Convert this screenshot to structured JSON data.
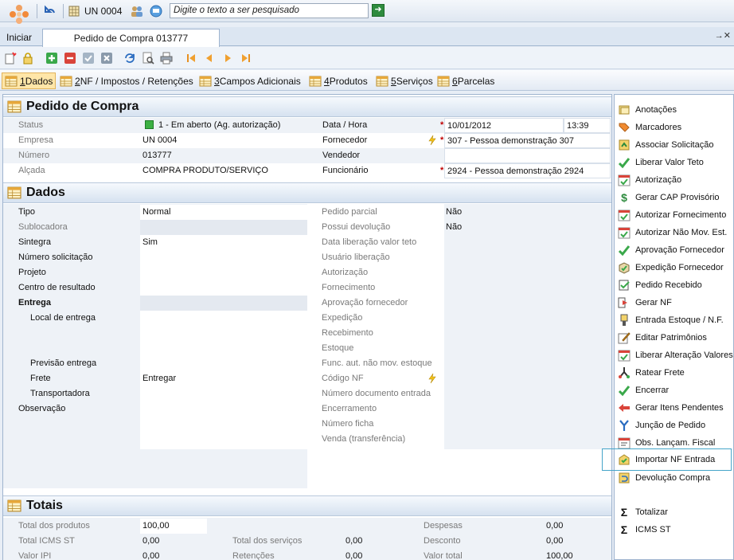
{
  "topbar": {
    "unit_label": "UN 0004",
    "search_placeholder": "Digite o texto a ser pesquisado"
  },
  "tabs": {
    "home": "Iniciar",
    "active": "Pedido de Compra 013777",
    "close_glyph": "→✕"
  },
  "section_tabs": [
    {
      "num": "1",
      "label": " Dados"
    },
    {
      "num": "2",
      "label": " NF / Impostos / Retenções"
    },
    {
      "num": "3",
      "label": " Campos Adicionais"
    },
    {
      "num": "4",
      "label": " Produtos"
    },
    {
      "num": "5",
      "label": " Serviços"
    },
    {
      "num": "6",
      "label": " Parcelas"
    }
  ],
  "pedido": {
    "title": "Pedido de Compra",
    "status_label": "Status",
    "status_value": "1 - Em aberto (Ag. autorização)",
    "empresa_label": "Empresa",
    "empresa_value": "UN 0004",
    "numero_label": "Número",
    "numero_value": "013777",
    "alcada_label": "Alçada",
    "alcada_value": "COMPRA PRODUTO/SERVIÇO",
    "data_label": "Data / Hora",
    "data_value": "10/01/2012",
    "hora_value": "13:39",
    "fornecedor_label": "Fornecedor",
    "fornecedor_value": "307 - Pessoa demonstração 307",
    "vendedor_label": "Vendedor",
    "funcionario_label": "Funcionário",
    "funcionario_value": "2924 - Pessoa demonstração 2924",
    "required_mark": "*"
  },
  "dados": {
    "title": "Dados",
    "left": [
      {
        "label": "Tipo",
        "value": "Normal",
        "style": "lbl",
        "bg": "white"
      },
      {
        "label": "Sublocadora",
        "value": "",
        "style": "lbl-gray",
        "bg": "gray"
      },
      {
        "label": "Sintegra",
        "value": "Sim",
        "style": "lbl",
        "bg": "white"
      },
      {
        "label": "Número solicitação",
        "value": "",
        "style": "lbl",
        "bg": "white"
      },
      {
        "label": "Projeto",
        "value": "",
        "style": "lbl",
        "bg": "white"
      },
      {
        "label": "Centro de resultado",
        "value": "",
        "style": "lbl",
        "bg": "white"
      },
      {
        "label": "Entrega",
        "value": "",
        "style": "bold",
        "bg": "gray"
      }
    ],
    "local_entrega_label": "Local de entrega",
    "previsao_label": "Previsão entrega",
    "frete_label": "Frete",
    "frete_value": "Entregar",
    "transportadora_label": "Transportadora",
    "observacao_label": "Observação",
    "right": [
      {
        "label": "Pedido parcial",
        "value": "Não"
      },
      {
        "label": "Possui devolução",
        "value": "Não"
      },
      {
        "label": "Data liberação valor teto",
        "value": ""
      },
      {
        "label": "Usuário liberação",
        "value": ""
      },
      {
        "label": "Autorização",
        "value": ""
      },
      {
        "label": "Fornecimento",
        "value": ""
      },
      {
        "label": "Aprovação fornecedor",
        "value": ""
      },
      {
        "label": "Expedição",
        "value": ""
      },
      {
        "label": "Recebimento",
        "value": ""
      },
      {
        "label": "Estoque",
        "value": ""
      },
      {
        "label": "Func. aut. não mov. estoque",
        "value": ""
      },
      {
        "label": "Código NF",
        "value": ""
      },
      {
        "label": "Número documento entrada",
        "value": ""
      },
      {
        "label": "Encerramento",
        "value": ""
      },
      {
        "label": "Número ficha",
        "value": ""
      },
      {
        "label": "Venda (transferência)",
        "value": ""
      }
    ]
  },
  "totais": {
    "title": "Totais",
    "rows": [
      [
        {
          "label": "Total dos produtos",
          "value": "100,00"
        },
        {
          "label": "",
          "value": ""
        },
        {
          "label": "Despesas",
          "value": "0,00"
        }
      ],
      [
        {
          "label": "Total ICMS ST",
          "value": "0,00"
        },
        {
          "label": "Total dos serviços",
          "value": "0,00"
        },
        {
          "label": "Desconto",
          "value": "0,00"
        }
      ],
      [
        {
          "label": "Valor IPI",
          "value": "0,00"
        },
        {
          "label": "Retenções",
          "value": "0,00"
        },
        {
          "label": "Valor total",
          "value": "100,00"
        }
      ]
    ]
  },
  "sidebar": {
    "items": [
      {
        "label": "Anotações",
        "icon": "notes-icon",
        "accel": "A"
      },
      {
        "label": "Marcadores",
        "icon": "tag-icon"
      },
      {
        "label": "Associar Solicitação",
        "icon": "link-request-icon"
      },
      {
        "label": "Liberar Valor Teto",
        "icon": "check-icon"
      },
      {
        "label": "Autorização",
        "icon": "calendar-check-icon"
      },
      {
        "label": "Gerar CAP Provisório",
        "icon": "dollar-icon"
      },
      {
        "label": "Autorizar Fornecimento",
        "icon": "calendar-check-icon"
      },
      {
        "label": "Autorizar Não Mov. Est.",
        "icon": "calendar-check-icon"
      },
      {
        "label": "Aprovação Fornecedor",
        "icon": "check-icon"
      },
      {
        "label": "Expedição Fornecedor",
        "icon": "box-check-icon"
      },
      {
        "label": "Pedido Recebido",
        "icon": "received-icon"
      },
      {
        "label": "Gerar NF",
        "icon": "arrow-doc-icon"
      },
      {
        "label": "Entrada Estoque / N.F.",
        "icon": "stock-entry-icon"
      },
      {
        "label": "Editar Patrimônios",
        "icon": "edit-icon"
      },
      {
        "label": "Liberar Alteração Valores",
        "icon": "calendar-check-icon"
      },
      {
        "label": "Ratear Frete",
        "icon": "split-icon"
      },
      {
        "label": "Encerrar",
        "icon": "check-icon"
      },
      {
        "label": "Gerar Itens Pendentes",
        "icon": "back-arrow-icon"
      },
      {
        "label": "Junção de Pedido",
        "icon": "merge-icon"
      },
      {
        "label": "Obs. Lançam. Fiscal",
        "icon": "calendar-obs-icon",
        "accel": "O"
      },
      {
        "label": "Importar NF Entrada",
        "icon": "import-icon"
      },
      {
        "label": "Devolução Compra",
        "icon": "return-icon"
      }
    ],
    "bottom": [
      {
        "label": "Totalizar",
        "icon": "sigma-icon"
      },
      {
        "label": "ICMS ST",
        "icon": "sigma-icon"
      }
    ]
  },
  "colors": {
    "accent": "#ffe6a8",
    "highlight_border": "#46a5c9",
    "status_green": "#3cb043",
    "required": "#c00000"
  }
}
